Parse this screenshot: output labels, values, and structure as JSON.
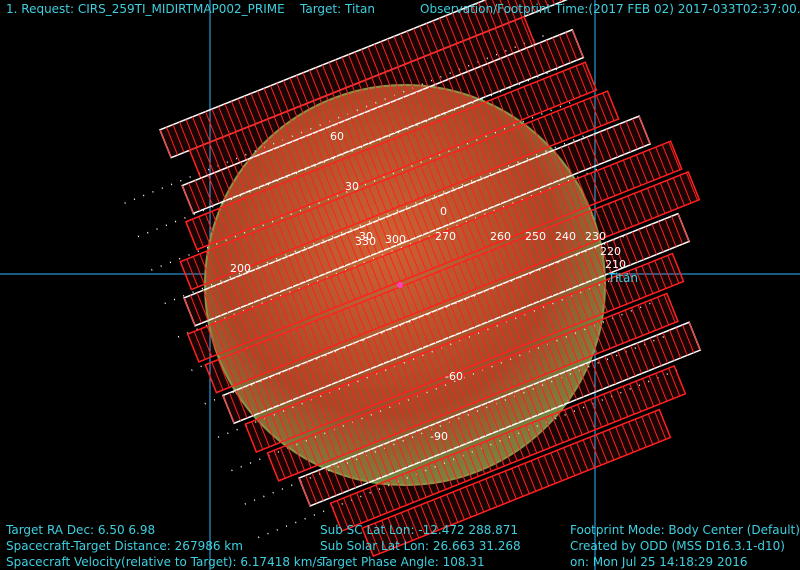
{
  "header": {
    "request": "1. Request: CIRS_259TI_MIDIRTMAP002_PRIME",
    "target": "Target: Titan",
    "time": "Observation/Footprint Time:(2017 FEB 02) 2017-033T02:37:00.62"
  },
  "target_label": "Titan",
  "grid_labels": [
    "60",
    "30",
    "0",
    "-30",
    "-60",
    "-90",
    "330",
    "300",
    "270",
    "260",
    "250",
    "240",
    "230",
    "220",
    "210",
    "200"
  ],
  "footer": {
    "left": [
      "Target RA Dec:  6.50   6.98",
      "Spacecraft-Target Distance:  267986 km",
      "Spacecraft Velocity(relative to Target): 6.17418 km/s"
    ],
    "middle": [
      "Sub SC Lat Lon: -12.472  288.871",
      "Sub Solar Lat Lon: 26.663  31.268",
      "Target Phase Angle: 108.31"
    ],
    "right": [
      "Footprint Mode: Body Center (Default)",
      "Created by ODD (MSS D16.3.1-d10)",
      "on: Mon Jul 25 14:18:29 2016"
    ]
  },
  "colors": {
    "text": "#3fd0e0",
    "footprint": "#ff2020",
    "body": "#b05a2a",
    "grid": "#ffffff",
    "crosshair": "#2fb6ff"
  }
}
